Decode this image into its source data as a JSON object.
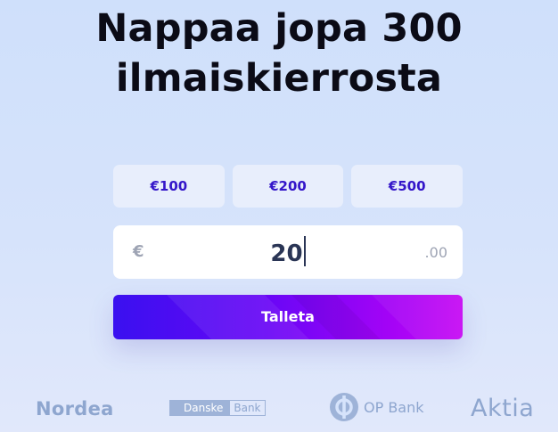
{
  "headline": {
    "line1": "Nappaa jopa 300",
    "line2": "ilmaiskierrosta"
  },
  "presets": [
    {
      "label": "€100"
    },
    {
      "label": "€200"
    },
    {
      "label": "€500"
    }
  ],
  "amount_input": {
    "currency_symbol": "€",
    "value": "20",
    "decimals": ".00"
  },
  "deposit_button": {
    "label": "Talleta"
  },
  "banks": {
    "nordea": "Nordea",
    "danske_part1": "Danske",
    "danske_part2": "Bank",
    "op": "OP Bank",
    "aktia": "Aktia"
  },
  "colors": {
    "accent": "#3416c9",
    "button_start": "#3a10f0",
    "button_end": "#c70af4",
    "bank_logo": "#8ea6cf"
  }
}
